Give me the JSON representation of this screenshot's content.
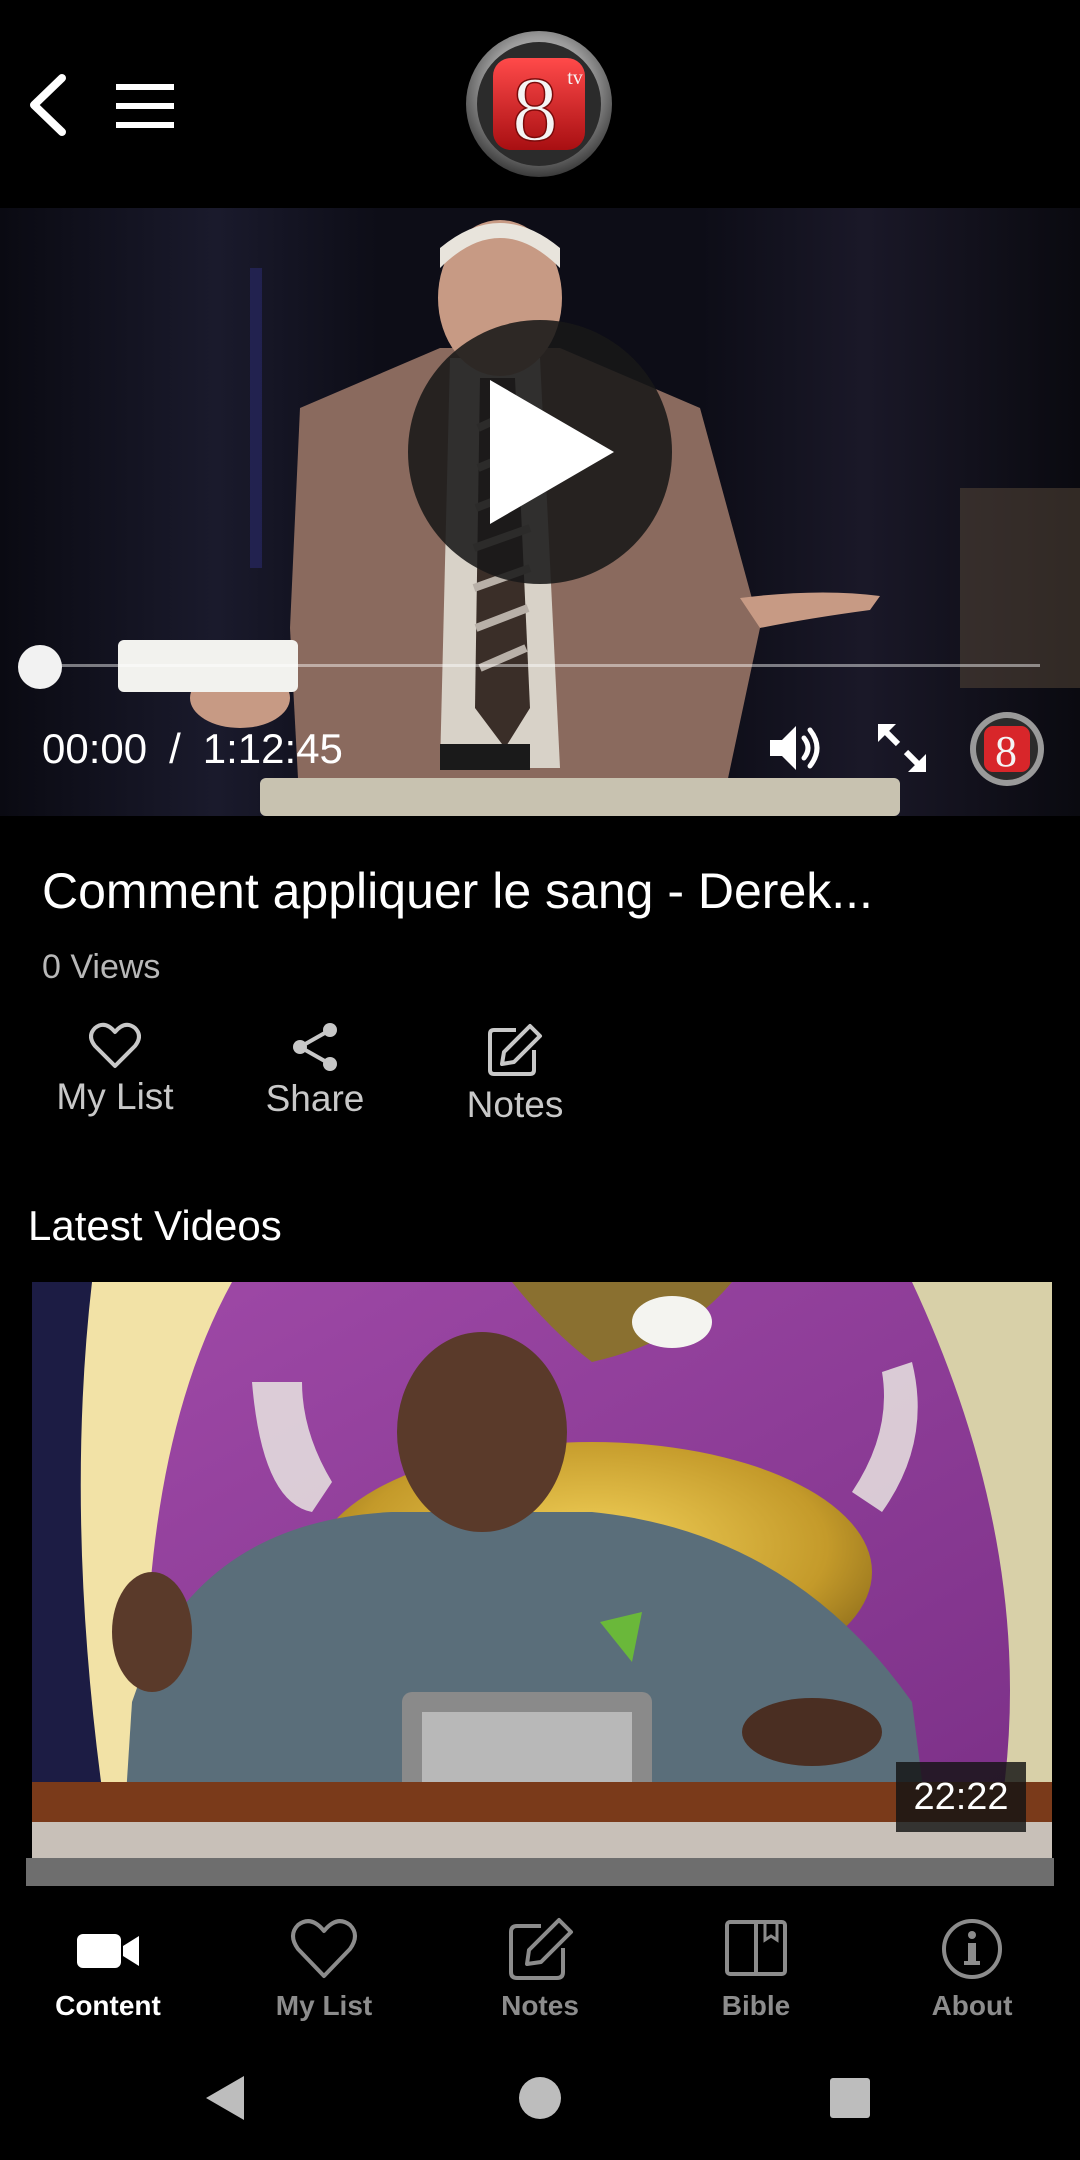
{
  "header": {
    "logo_text": "8",
    "logo_sub": "tv"
  },
  "player": {
    "current_time": "00:00",
    "separator": "/",
    "total_time": "1:12:45",
    "progress": 0.0
  },
  "video": {
    "title": "Comment appliquer le sang - Derek...",
    "views": "0 Views"
  },
  "actions": [
    {
      "label": "My List",
      "icon": "heart-icon"
    },
    {
      "label": "Share",
      "icon": "share-icon"
    },
    {
      "label": "Notes",
      "icon": "edit-icon"
    }
  ],
  "latest": {
    "section_title": "Latest Videos",
    "items": [
      {
        "duration": "22:22"
      }
    ]
  },
  "bottom_nav": [
    {
      "label": "Content",
      "icon": "video-camera-icon",
      "active": true
    },
    {
      "label": "My List",
      "icon": "heart-icon",
      "active": false
    },
    {
      "label": "Notes",
      "icon": "edit-icon",
      "active": false
    },
    {
      "label": "Bible",
      "icon": "book-icon",
      "active": false
    },
    {
      "label": "About",
      "icon": "info-icon",
      "active": false
    }
  ],
  "colors": {
    "background": "#000000",
    "brand_red": "#d8262a",
    "active_tab": "#ffffff",
    "inactive_tab": "#8c8c8c"
  }
}
